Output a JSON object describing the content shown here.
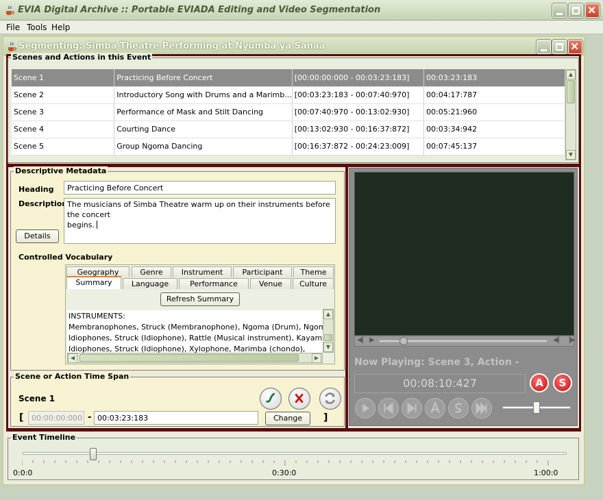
{
  "window": {
    "title": "EVIA Digital Archive :: Portable EVIADA Editing and Video Segmentation"
  },
  "menu": [
    "File",
    "Tools",
    "Help"
  ],
  "inner_window": {
    "title": "Segmenting: Simba Theatre Performing at Nyumba ya Sanaa"
  },
  "scenes": {
    "legend": "Scenes and Actions in this Event",
    "rows": [
      {
        "scene": "Scene 1",
        "title": "Practicing Before Concert",
        "range": "[00:00:00:000 - 00:03:23:183]",
        "duration": "00:03:23:183"
      },
      {
        "scene": "Scene 2",
        "title": "Introductory Song with Drums and a Marimb...",
        "range": "[00:03:23:183 - 00:07:40:970]",
        "duration": "00:04:17:787"
      },
      {
        "scene": "Scene 3",
        "title": "Performance of Mask and Stilt Dancing",
        "range": "[00:07:40:970 - 00:13:02:930]",
        "duration": "00:05:21:960"
      },
      {
        "scene": "Scene 4",
        "title": "Courting Dance",
        "range": "[00:13:02:930 - 00:16:37:872]",
        "duration": "00:03:34:942"
      },
      {
        "scene": "Scene 5",
        "title": "Group Ngoma Dancing",
        "range": "[00:16:37:872 - 00:24:23:009]",
        "duration": "00:07:45:137"
      }
    ]
  },
  "metadata": {
    "legend": "Descriptive Metadata",
    "heading_label": "Heading",
    "heading_value": "Practicing Before Concert",
    "description_label": "Description",
    "description_line1": "The musicians of Simba Theatre warm up on their instruments before the concert",
    "description_line2": "begins.",
    "details_button": "Details",
    "vocab_label": "Controlled Vocabulary",
    "tabs_back": [
      "Geography",
      "Genre",
      "Instrument",
      "Participant",
      "Theme"
    ],
    "tabs_front": [
      "Summary",
      "Language",
      "Performance",
      "Venue",
      "Culture"
    ],
    "refresh_button": "Refresh Summary",
    "summary_lines": [
      "INSTRUMENTS:",
      "Membranophones, Struck (Membranophone), Ngoma (Drum), Ngom",
      "Idiophones, Struck (Idiophone), Rattle (Musical instrument), Kayamb",
      "Idiophones, Struck (Idiophone), Xylophone, Marimba (chondo),"
    ]
  },
  "timespan": {
    "legend": "Scene or Action Time Span",
    "scene_label": "Scene 1",
    "open_bracket": "[",
    "dash": "-",
    "close_bracket": "]",
    "start": "00:00:00:000",
    "end": "00:03:23:183",
    "change_button": "Change"
  },
  "player": {
    "now_playing": "Now Playing: Scene 3, Action -",
    "time": "00:08:10:427",
    "a_button": "A",
    "s_button": "S",
    "seek_position": 0.05,
    "volume": 0.5
  },
  "timeline": {
    "legend": "Event Timeline",
    "start_label": "0:0:0",
    "mid_label": "0:30:0",
    "end_label": "1:00:0",
    "position": 0.13
  }
}
